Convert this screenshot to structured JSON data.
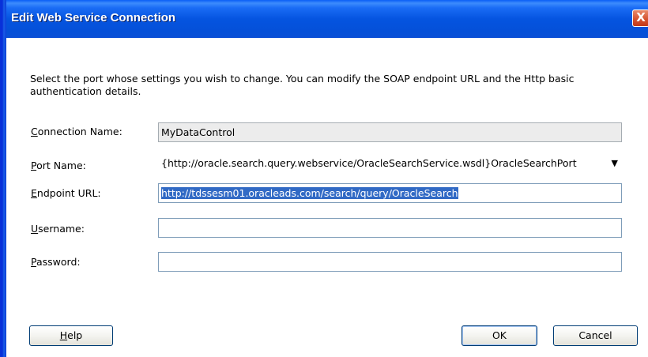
{
  "window": {
    "title": "Edit Web Service Connection",
    "close_label": "X"
  },
  "intro_text": "Select the port whose settings you wish to change. You can modify the SOAP endpoint URL and the Http basic authentication details.",
  "form": {
    "connection_name": {
      "label_first": "C",
      "label_rest": "onnection Name:",
      "value": "MyDataControl"
    },
    "port_name": {
      "label_first": "P",
      "label_rest": "ort Name:",
      "value": "{http://oracle.search.query.webservice/OracleSearchService.wsdl}OracleSearchPort"
    },
    "endpoint_url": {
      "label_first": "E",
      "label_rest": "ndpoint URL:",
      "value": "http://tdssesm01.oracleads.com/search/query/OracleSearch"
    },
    "username": {
      "label_first": "U",
      "label_rest": "sername:",
      "value": ""
    },
    "password": {
      "label_first": "P",
      "label_rest": "assword:",
      "value": ""
    }
  },
  "buttons": {
    "help_first": "H",
    "help_rest": "elp",
    "ok": "OK",
    "cancel": "Cancel"
  }
}
